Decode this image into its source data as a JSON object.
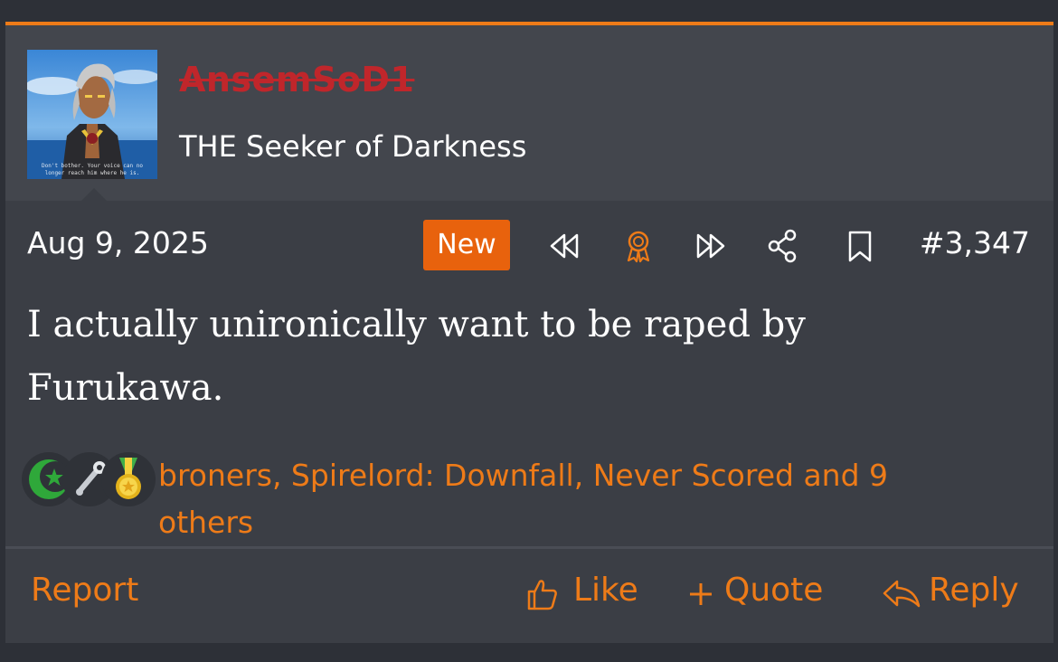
{
  "user": {
    "username": "AnsemSoD1",
    "title": "THE Seeker of Darkness",
    "avatar_caption_1": "Don't bother. Your voice can no",
    "avatar_caption_2": "longer reach him where he is."
  },
  "post": {
    "date": "Aug 9, 2025",
    "new_badge": "New",
    "number": "#3,347",
    "message_line_1": "I actually unironically want to be raped by",
    "message_line_2": "Furukawa.",
    "nav_icons": [
      "rewind-icon",
      "award-icon",
      "fast-forward-icon",
      "share-icon",
      "bookmark-icon"
    ]
  },
  "reactions": {
    "icons": [
      "star-crescent-icon",
      "wrench-icon",
      "medal-icon"
    ],
    "text_line_1": "broners, Spirelord: Downfall, Never Scored and 9",
    "text_line_2": "others"
  },
  "actions": {
    "report": "Report",
    "like": "Like",
    "quote": "Quote",
    "reply": "Reply"
  },
  "colors": {
    "accent": "#ee7b18",
    "username": "#c0262b",
    "badge": "#e8620d"
  }
}
